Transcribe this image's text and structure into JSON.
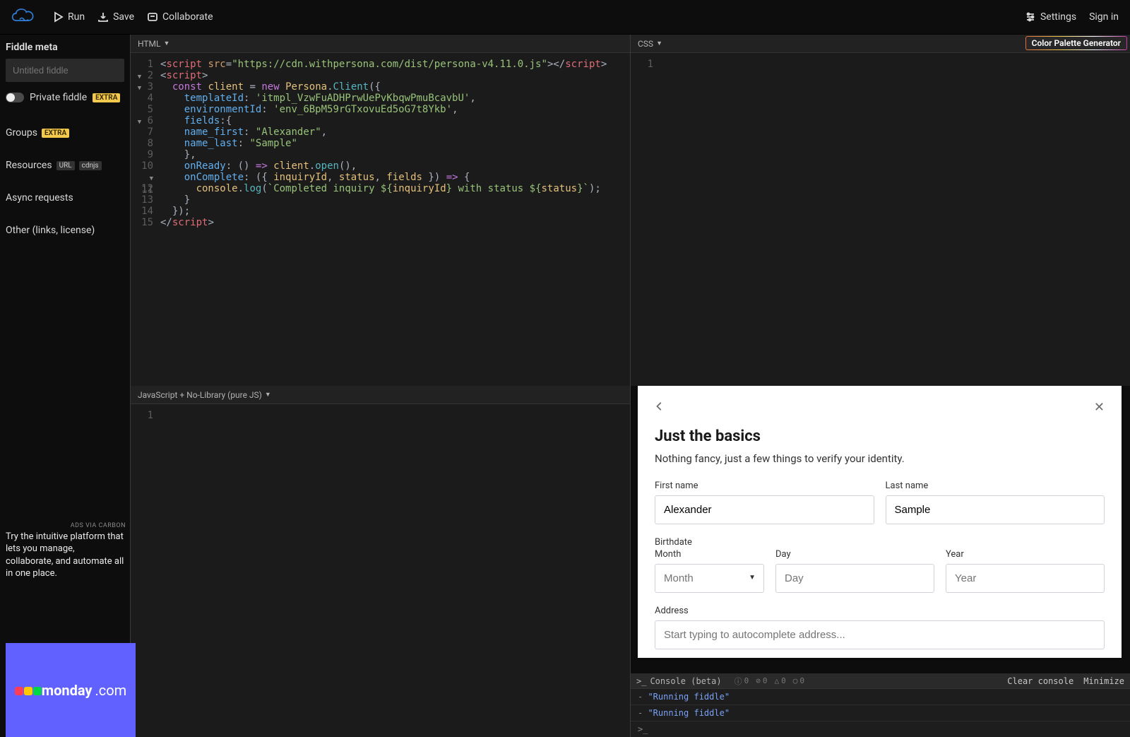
{
  "topbar": {
    "run": "Run",
    "save": "Save",
    "collaborate": "Collaborate",
    "settings": "Settings",
    "signin": "Sign in"
  },
  "sidebar": {
    "heading": "Fiddle meta",
    "untitled_placeholder": "Untitled fiddle",
    "private_label": "Private fiddle",
    "extra": "EXTRA",
    "groups": "Groups",
    "resources": "Resources",
    "url": "URL",
    "cdnjs": "cdnjs",
    "async": "Async requests",
    "other": "Other (links, license)",
    "ads_via": "ADS VIA CARBON",
    "ad_text": "Try the intuitive platform that lets you manage, collaborate, and automate all in one place.",
    "ad_brand": "monday",
    "ad_tld": ".com"
  },
  "panes": {
    "html_label": "HTML",
    "css_label": "CSS",
    "js_label": "JavaScript + No-Library (pure JS)",
    "cpg": "Color Palette Generator"
  },
  "code": {
    "script_src": "https://cdn.withpersona.com/dist/persona-v4.11.0.js",
    "template_id": "itmpl_VzwFuADHPrwUePvKbqwPmuBcavbU",
    "environment_id": "env_6BpM59rGTxovuEd5oG7t8Ykb",
    "name_first": "Alexander",
    "name_last": "Sample",
    "log_prefix": "Completed inquiry ${",
    "log_mid": "} with status ${",
    "log_suffix": "}"
  },
  "persona": {
    "title": "Just the basics",
    "subtitle": "Nothing fancy, just a few things to verify your identity.",
    "first_name_label": "First name",
    "first_name_value": "Alexander",
    "last_name_label": "Last name",
    "last_name_value": "Sample",
    "birthdate_label": "Birthdate",
    "month_label": "Month",
    "month_placeholder": "Month",
    "day_label": "Day",
    "day_placeholder": "Day",
    "year_label": "Year",
    "year_placeholder": "Year",
    "address_label": "Address",
    "address_placeholder": "Start typing to autocomplete address..."
  },
  "console": {
    "title": "Console (beta)",
    "clear": "Clear console",
    "minimize": "Minimize",
    "line1": "\"Running fiddle\"",
    "line2": "\"Running fiddle\"",
    "prompt": ">_",
    "badge_info": "0",
    "badge_warn": "0",
    "badge_err": "0",
    "badge_dbg": "0"
  }
}
